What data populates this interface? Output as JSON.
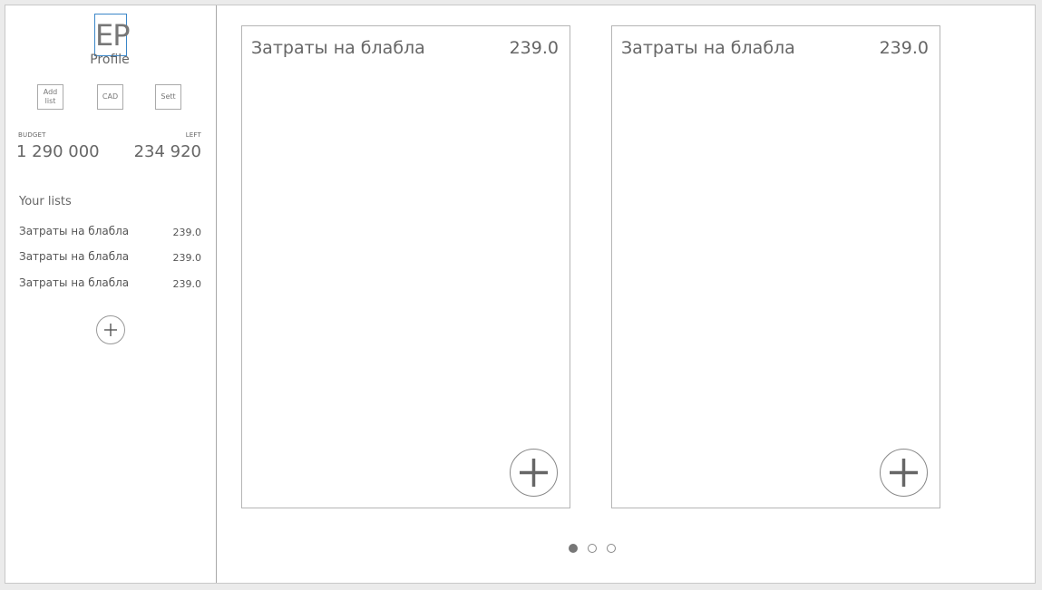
{
  "sidebar": {
    "avatar_initials": "EP",
    "profile_label": "Profile",
    "buttons": {
      "add_list": "Add list",
      "cad": "CAD",
      "settings": "Sett"
    },
    "budget": {
      "budget_caption": "BUDGET",
      "budget_value": "1 290 000",
      "left_caption": "LEFT",
      "left_value": "234 920"
    },
    "lists_title": "Your lists",
    "lists": [
      {
        "name": "Затраты на блабла",
        "amount": "239.0"
      },
      {
        "name": "Затраты на блабла",
        "amount": "239.0"
      },
      {
        "name": "Затраты на блабла",
        "amount": "239.0"
      }
    ]
  },
  "main": {
    "cards": [
      {
        "title": "Затраты на блабла",
        "total": "239.0"
      },
      {
        "title": "Затраты на блабла",
        "total": "239.0"
      }
    ],
    "pagination": {
      "pages": 3,
      "current": 1
    }
  }
}
